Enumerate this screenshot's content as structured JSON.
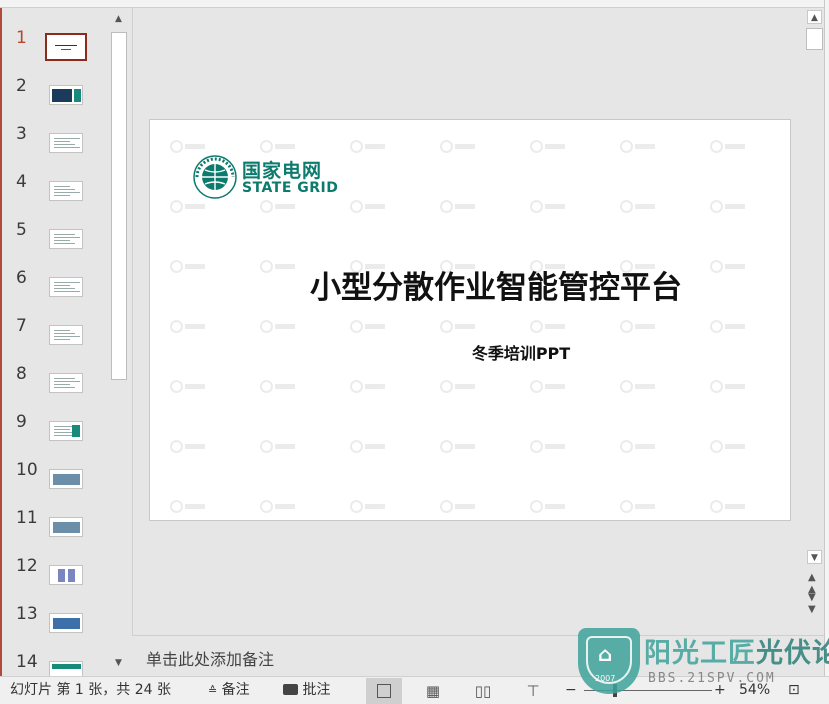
{
  "thumbnails": {
    "items": [
      {
        "num": "1"
      },
      {
        "num": "2"
      },
      {
        "num": "3"
      },
      {
        "num": "4"
      },
      {
        "num": "5"
      },
      {
        "num": "6"
      },
      {
        "num": "7"
      },
      {
        "num": "8"
      },
      {
        "num": "9"
      },
      {
        "num": "10"
      },
      {
        "num": "11"
      },
      {
        "num": "12"
      },
      {
        "num": "13"
      },
      {
        "num": "14"
      }
    ],
    "selected": "1"
  },
  "slide": {
    "logo_cn": "国家电网",
    "logo_en": "STATE GRID",
    "title": "小型分散作业智能管控平台",
    "subtitle": "冬季培训PPT"
  },
  "notes": {
    "placeholder": "单击此处添加备注"
  },
  "status": {
    "slide_info": "幻灯片 第 1 张，共 24 张",
    "notes_label": "备注",
    "comments_label": "批注",
    "zoom_minus": "−",
    "zoom_plus": "+",
    "zoom": "54%"
  },
  "badge": {
    "title_a": "阳光工匠",
    "title_b": "光伏论坛",
    "url": "BBS.21SPV.COM",
    "year": "2007"
  },
  "colors": {
    "accent": "#b7472a",
    "brand": "#0c7a6d",
    "badge": "#3fa39b"
  }
}
